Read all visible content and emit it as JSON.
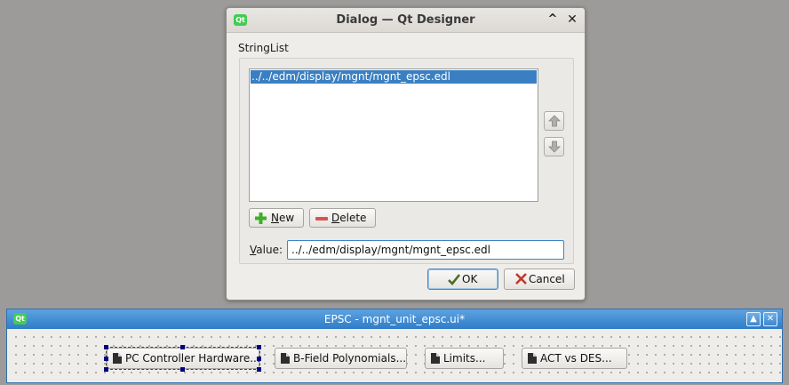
{
  "dialog": {
    "title": "Dialog — Qt Designer",
    "logo_text": "Qt",
    "minimize_glyph": "^",
    "close_glyph": "✕",
    "group_label": "StringList",
    "list_items": [
      "../../edm/display/mgnt/mgnt_epsc.edl"
    ],
    "selected_index": 0,
    "move_up_icon": "arrow-up-icon",
    "move_down_icon": "arrow-down-icon",
    "new_button": {
      "mnemonic": "N",
      "rest": "ew",
      "icon": "plus-icon",
      "icon_color": "#3fae2a"
    },
    "delete_button": {
      "mnemonic": "D",
      "rest": "elete",
      "icon": "minus-icon",
      "icon_color": "#d9534f"
    },
    "value_label": {
      "mnemonic": "V",
      "rest": "alue:"
    },
    "value_input": "../../edm/display/mgnt/mgnt_epsc.edl",
    "ok_button": {
      "label": "OK",
      "icon": "check-icon"
    },
    "cancel_button": {
      "label": "Cancel",
      "icon": "x-icon",
      "icon_color": "#c0392b"
    }
  },
  "form_window": {
    "title": "EPSC - mgnt_unit_epsc.ui*",
    "logo_text": "Qt",
    "title_bar_color": "#3a86d0",
    "maximize_glyph": "▲",
    "close_glyph": "✕",
    "buttons": [
      {
        "label": "PC Controller Hardware...",
        "icon": "document-icon",
        "selected": true
      },
      {
        "label": "B-Field Polynomials...",
        "icon": "document-icon",
        "selected": false
      },
      {
        "label": "Limits...",
        "icon": "document-icon",
        "selected": false
      },
      {
        "label": "ACT vs DES...",
        "icon": "document-icon",
        "selected": false
      }
    ]
  }
}
